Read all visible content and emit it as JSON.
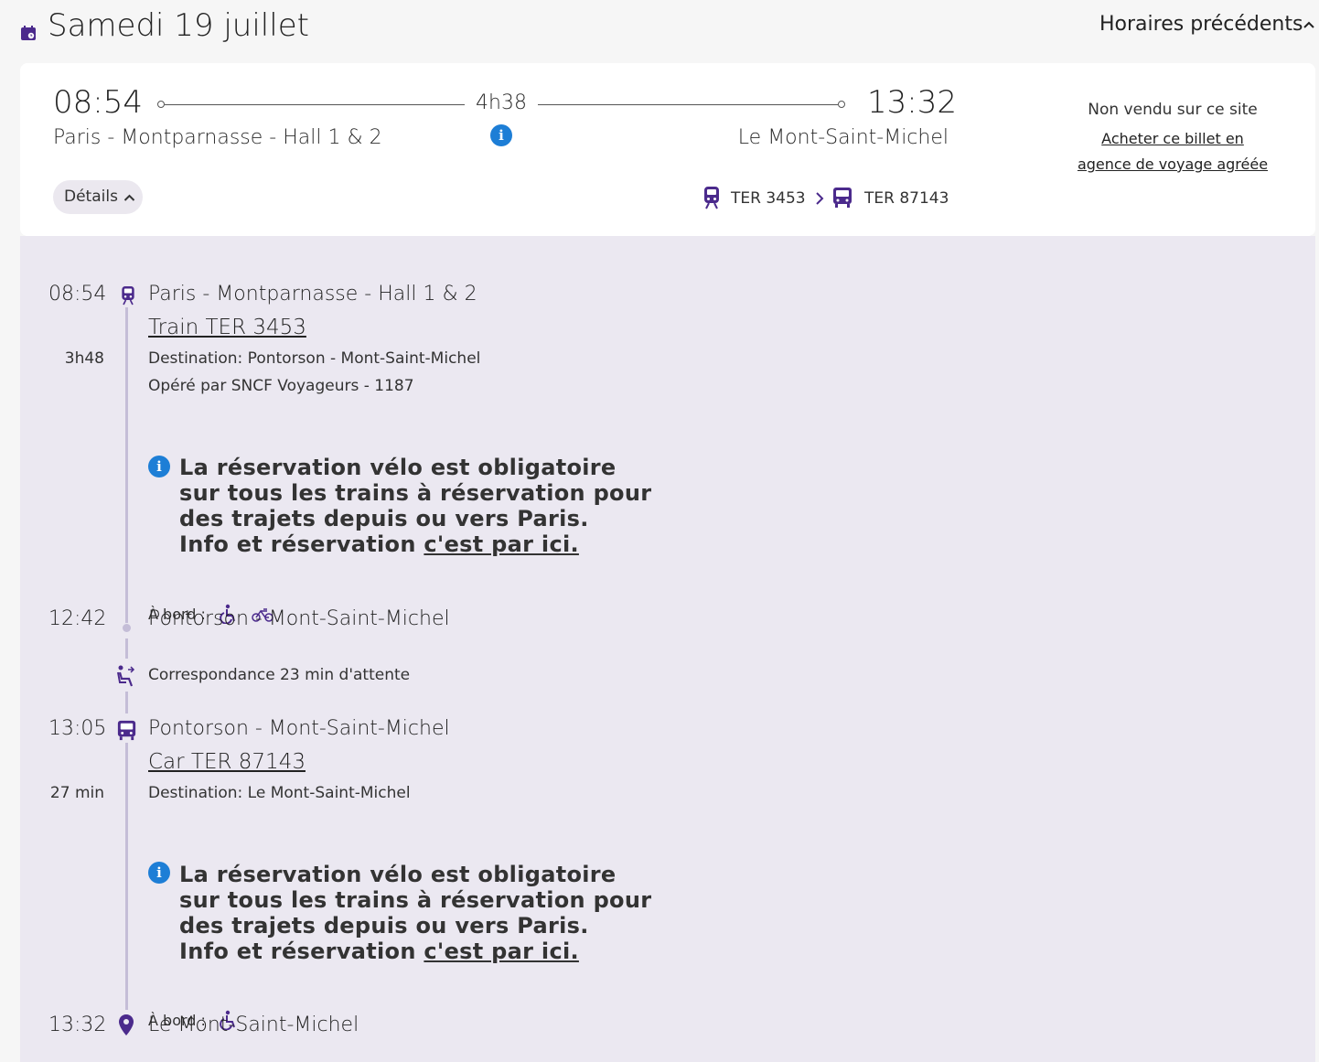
{
  "header": {
    "date_title": "Samedi 19 juillet",
    "previous_link": "Horaires précédents"
  },
  "summary": {
    "departure_time": "08:54",
    "arrival_time": "13:32",
    "departure_station": "Paris - Montparnasse - Hall 1 & 2",
    "arrival_station": "Le Mont-Saint-Michel",
    "duration": "4h38",
    "details_button": "Détails",
    "legs": [
      {
        "label": "TER 3453",
        "icon": "train-icon"
      },
      {
        "label": "TER 87143",
        "icon": "bus-icon"
      }
    ],
    "sale_status": "Non vendu sur ce site",
    "agency_link": "Acheter ce billet en agence de voyage agréée"
  },
  "timeline": {
    "segment1": {
      "dep_time": "08:54",
      "dep_station": "Paris - Montparnasse - Hall 1 & 2",
      "train_link": "Train TER 3453",
      "duration": "3h48",
      "destination": "Destination: Pontorson - Mont-Saint-Michel",
      "operator": "Opéré par SNCF Voyageurs - 1187",
      "notice": "La réservation vélo est obligatoire sur tous les trains à réservation pour des trajets depuis ou vers Paris.",
      "notice_info_prefix": "Info et réservation",
      "notice_link": "c'est par ici.",
      "onboard": "À bord :",
      "arr_time": "12:42",
      "arr_station": "Pontorson - Mont-Saint-Michel"
    },
    "connection": "Correspondance 23 min d'attente",
    "segment2": {
      "dep_time": "13:05",
      "dep_station": "Pontorson - Mont-Saint-Michel",
      "train_link": "Car TER 87143",
      "duration": "27 min",
      "destination": "Destination: Le Mont-Saint-Michel",
      "notice": "La réservation vélo est obligatoire sur tous les trains à réservation pour des trajets depuis ou vers Paris.",
      "notice_info_prefix": "Info et réservation",
      "notice_link": "c'est par ici.",
      "onboard": "À bord :",
      "arr_time": "13:32",
      "arr_station": "Le Mont-Saint-Michel"
    }
  },
  "colors": {
    "accent_purple": "#4b2a8c",
    "info_blue": "#1d7ed6",
    "panel_bg": "#ebe8f1",
    "timeline_line": "#c4bdd7"
  }
}
